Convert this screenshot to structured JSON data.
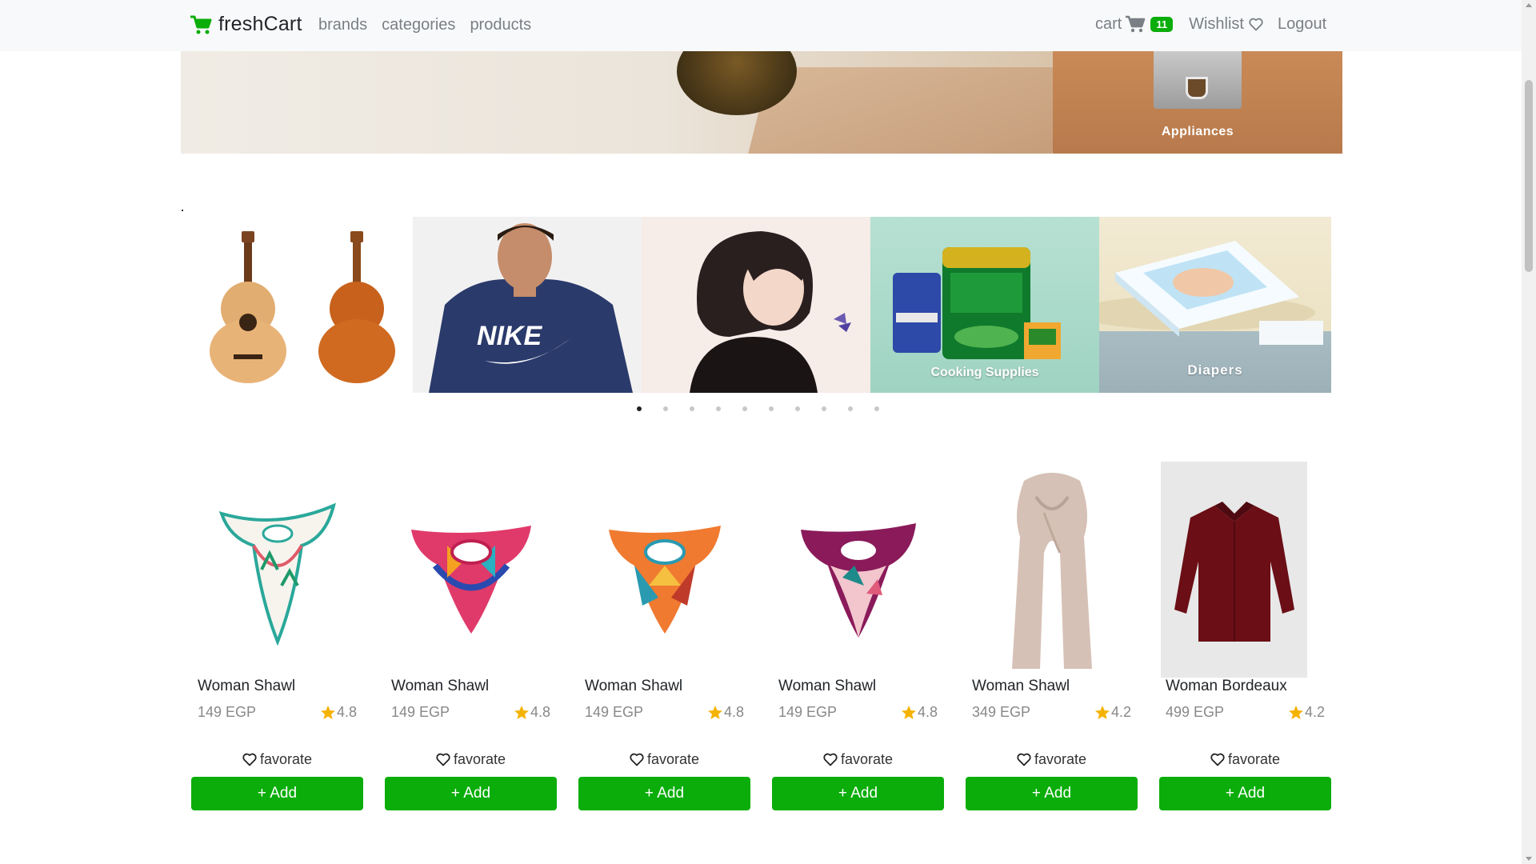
{
  "navbar": {
    "brand": "freshCart",
    "links": [
      "brands",
      "categories",
      "products"
    ],
    "cart_label": "cart",
    "cart_count": "11",
    "wishlist_label": "Wishlist",
    "logout_label": "Logout",
    "accent_color": "#0aad0a"
  },
  "top_banner": {
    "side_label": "Appliances"
  },
  "category_slider": {
    "slides": [
      {
        "caption": ""
      },
      {
        "caption": ""
      },
      {
        "caption": ""
      },
      {
        "caption": "Cooking Supplies"
      },
      {
        "caption": "Diapers"
      }
    ],
    "dot_count": 10,
    "active_dot": 1,
    "logo_text": "NIKE"
  },
  "products": [
    {
      "title": "Woman Shawl",
      "price": "149 EGP",
      "rating": "4.8",
      "favorite_label": "favorate",
      "add_label": "+ Add"
    },
    {
      "title": "Woman Shawl",
      "price": "149 EGP",
      "rating": "4.8",
      "favorite_label": "favorate",
      "add_label": "+ Add"
    },
    {
      "title": "Woman Shawl",
      "price": "149 EGP",
      "rating": "4.8",
      "favorite_label": "favorate",
      "add_label": "+ Add"
    },
    {
      "title": "Woman Shawl",
      "price": "149 EGP",
      "rating": "4.8",
      "favorite_label": "favorate",
      "add_label": "+ Add"
    },
    {
      "title": "Woman Shawl",
      "price": "349 EGP",
      "rating": "4.2",
      "favorite_label": "favorate",
      "add_label": "+ Add"
    },
    {
      "title": "Woman Bordeaux",
      "price": "499 EGP",
      "rating": "4.2",
      "favorite_label": "favorate",
      "add_label": "+ Add"
    }
  ],
  "colors": {
    "star": "#f5b301",
    "button": "#0aad0a"
  }
}
